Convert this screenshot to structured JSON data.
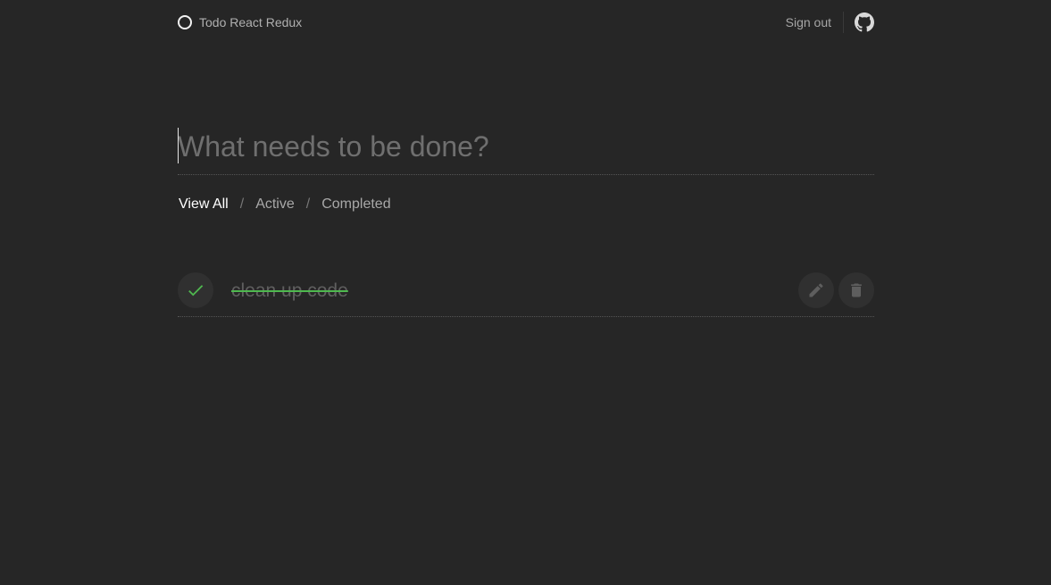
{
  "header": {
    "app_title": "Todo React Redux",
    "logo_icon": "circle-icon",
    "signout_label": "Sign out",
    "github_icon": "github-icon"
  },
  "new_task": {
    "placeholder": "What needs to be done?",
    "value": ""
  },
  "filters": {
    "items": [
      {
        "label": "View All",
        "active": true
      },
      {
        "label": "Active",
        "active": false
      },
      {
        "label": "Completed",
        "active": false
      }
    ],
    "separator": "/"
  },
  "tasks": [
    {
      "title": "clean up code",
      "completed": true,
      "status_icon": "checkmark-icon",
      "edit_icon": "pencil-icon",
      "delete_icon": "trash-icon"
    }
  ],
  "colors": {
    "background": "#262626",
    "accent_green": "#4fb84f",
    "active_filter": "#ffffff",
    "muted_text": "#a8a8a8"
  }
}
